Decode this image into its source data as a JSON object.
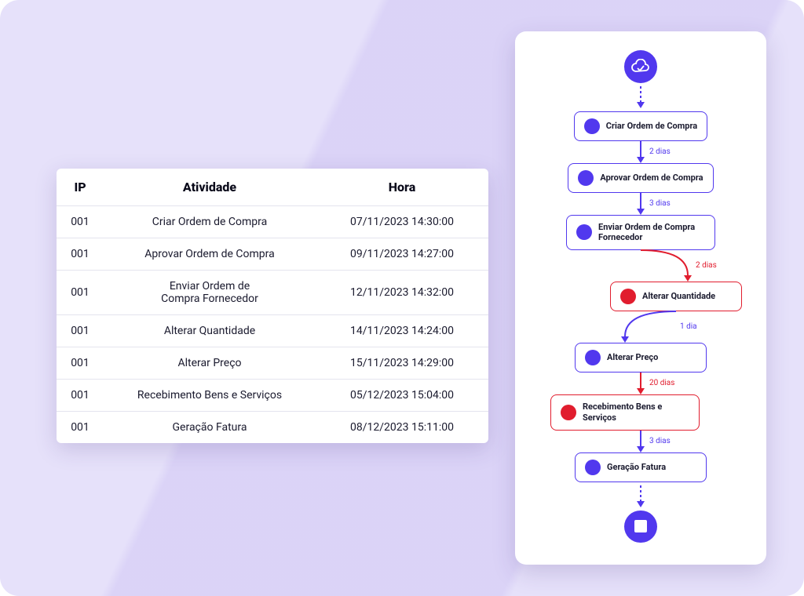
{
  "colors": {
    "primary": "#5138ee",
    "danger": "#e11d2e",
    "card_bg": "#ffffff",
    "canvas_bg": "#e6e1fa"
  },
  "table": {
    "headers": {
      "ip": "IP",
      "activity": "Atividade",
      "time": "Hora"
    },
    "rows": [
      {
        "ip": "001",
        "activity": "Criar Ordem de Compra",
        "time": "07/11/2023 14:30:00"
      },
      {
        "ip": "001",
        "activity": "Aprovar Ordem de Compra",
        "time": "09/11/2023 14:27:00"
      },
      {
        "ip": "001",
        "activity": "Enviar Ordem de\nCompra Fornecedor",
        "time": "12/11/2023 14:32:00"
      },
      {
        "ip": "001",
        "activity": "Alterar Quantidade",
        "time": "14/11/2023 14:24:00"
      },
      {
        "ip": "001",
        "activity": "Alterar Preço",
        "time": "15/11/2023 14:29:00"
      },
      {
        "ip": "001",
        "activity": "Recebimento Bens e Serviços",
        "time": "05/12/2023 15:04:00"
      },
      {
        "ip": "001",
        "activity": "Geração Fatura",
        "time": "08/12/2023 15:11:00"
      }
    ]
  },
  "flow": {
    "start_icon": "cloud-icon",
    "end_icon": "stop-icon",
    "nodes": [
      {
        "label": "Criar Ordem de Compra",
        "variant": "normal"
      },
      {
        "label": "Aprovar Ordem de Compra",
        "variant": "normal"
      },
      {
        "label": "Enviar Ordem de Compra Fornecedor",
        "variant": "normal"
      },
      {
        "label": "Alterar Quantidade",
        "variant": "red"
      },
      {
        "label": "Alterar Preço",
        "variant": "normal"
      },
      {
        "label": "Recebimento Bens e Serviços",
        "variant": "red"
      },
      {
        "label": "Geração Fatura",
        "variant": "normal"
      }
    ],
    "edges": [
      {
        "from": "start",
        "to": 0,
        "style": "dotted",
        "color": "primary",
        "label": ""
      },
      {
        "from": 0,
        "to": 1,
        "style": "solid",
        "color": "primary",
        "label": "2 dias"
      },
      {
        "from": 1,
        "to": 2,
        "style": "solid",
        "color": "primary",
        "label": "3 dias"
      },
      {
        "from": 2,
        "to": 3,
        "style": "curve-right",
        "color": "danger",
        "label": "2 dias"
      },
      {
        "from": 3,
        "to": 4,
        "style": "curve-left",
        "color": "primary",
        "label": "1 dia"
      },
      {
        "from": 4,
        "to": 5,
        "style": "solid",
        "color": "danger",
        "label": "20 dias"
      },
      {
        "from": 5,
        "to": 6,
        "style": "solid",
        "color": "primary",
        "label": "3 dias"
      },
      {
        "from": 6,
        "to": "end",
        "style": "dotted",
        "color": "primary",
        "label": ""
      }
    ]
  }
}
